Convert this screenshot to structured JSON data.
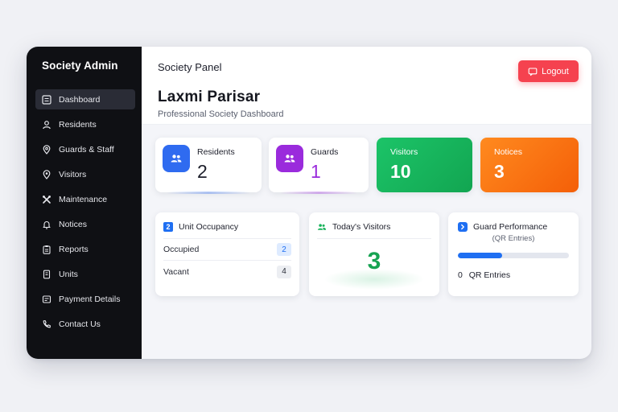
{
  "sidebar": {
    "title": "Society Admin",
    "items": [
      {
        "label": "Dashboard",
        "icon": "dashboard-icon",
        "active": true
      },
      {
        "label": "Residents",
        "icon": "user-icon"
      },
      {
        "label": "Guards & Staff",
        "icon": "location-pin-icon"
      },
      {
        "label": "Visitors",
        "icon": "map-pin-icon"
      },
      {
        "label": "Maintenance",
        "icon": "tools-icon"
      },
      {
        "label": "Notices",
        "icon": "bell-icon"
      },
      {
        "label": "Reports",
        "icon": "clipboard-icon"
      },
      {
        "label": "Units",
        "icon": "door-icon"
      },
      {
        "label": "Payment Details",
        "icon": "receipt-icon"
      },
      {
        "label": "Contact Us",
        "icon": "phone-icon"
      }
    ]
  },
  "header": {
    "panel_label": "Society Panel",
    "society_name": "Laxmi Parisar",
    "subtitle": "Professional Society Dashboard",
    "logout_label": "Logout"
  },
  "stats": [
    {
      "label": "Residents",
      "value": "2",
      "icon": "users-icon",
      "color": "#2f6bf0"
    },
    {
      "label": "Guards",
      "value": "1",
      "icon": "users-icon",
      "color": "#9a2bdc"
    },
    {
      "label": "Visitors",
      "value": "10",
      "color": "#17b25a"
    },
    {
      "label": "Notices",
      "value": "3",
      "color": "#fb6c0d"
    }
  ],
  "occupancy": {
    "title": "Unit Occupancy",
    "icon_text": "2",
    "rows": [
      {
        "label": "Occupied",
        "value": "2"
      },
      {
        "label": "Vacant",
        "value": "4"
      }
    ]
  },
  "todays_visitors": {
    "title": "Today's Visitors",
    "value": "3",
    "icon": "users-icon"
  },
  "guard_performance": {
    "title": "Guard Performance",
    "subtitle": "(QR Entries)",
    "progress_fraction": 0.4,
    "count": "0",
    "count_label": "QR Entries",
    "icon": "chevron-right-icon"
  },
  "colors": {
    "accent_blue": "#1f6ff2",
    "logout_red": "#f5424f",
    "visitors_green": "#17b25a",
    "notices_orange": "#fb6c0d",
    "guards_purple": "#9a2bdc"
  }
}
